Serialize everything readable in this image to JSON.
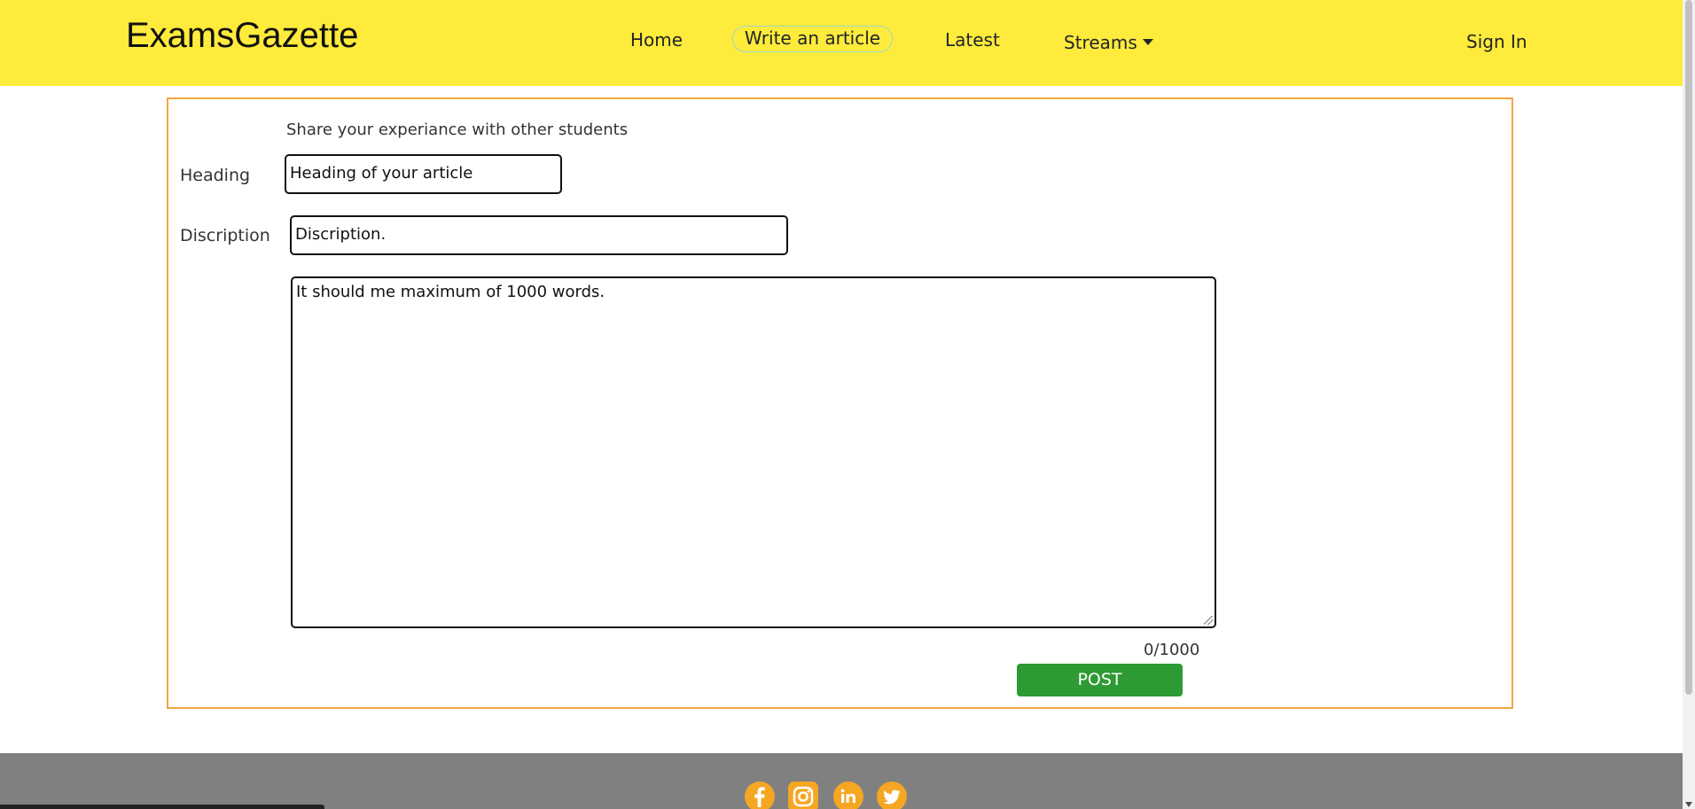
{
  "nav": {
    "brand": "ExamsGazette",
    "links": [
      {
        "label": "Home"
      },
      {
        "label": "Write an article"
      },
      {
        "label": "Latest"
      },
      {
        "label": "Streams"
      }
    ],
    "sign_in": "Sign In"
  },
  "form": {
    "intro": "Share your experiance with other students",
    "heading_label": "Heading",
    "heading_value": "Heading of your article",
    "description_label": "Discription",
    "description_value": "Discription.",
    "body_value": "It should me maximum of 1000 words.",
    "counter": "0/1000",
    "post_label": "POST"
  },
  "footer": {
    "social_icons": [
      "facebook-icon",
      "instagram-icon",
      "linkedin-icon",
      "twitter-icon"
    ]
  },
  "colors": {
    "navbar_bg": "#ffeb3b",
    "card_border": "#f4a640",
    "post_button": "#2e9a33",
    "footer_bg": "#808080",
    "social_icon": "#f5a623"
  }
}
